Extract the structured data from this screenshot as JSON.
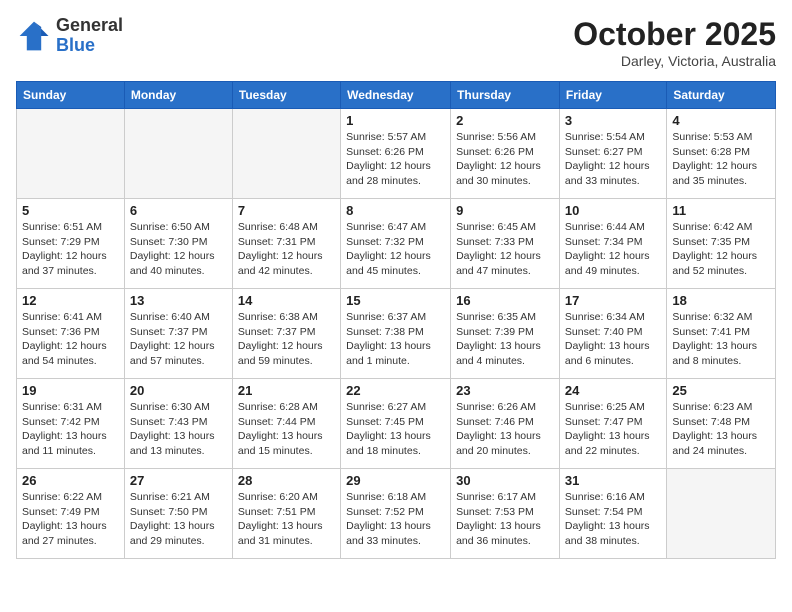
{
  "logo": {
    "general": "General",
    "blue": "Blue"
  },
  "title": {
    "month": "October 2025",
    "location": "Darley, Victoria, Australia"
  },
  "headers": [
    "Sunday",
    "Monday",
    "Tuesday",
    "Wednesday",
    "Thursday",
    "Friday",
    "Saturday"
  ],
  "weeks": [
    [
      {
        "day": "",
        "info": ""
      },
      {
        "day": "",
        "info": ""
      },
      {
        "day": "",
        "info": ""
      },
      {
        "day": "1",
        "info": "Sunrise: 5:57 AM\nSunset: 6:26 PM\nDaylight: 12 hours\nand 28 minutes."
      },
      {
        "day": "2",
        "info": "Sunrise: 5:56 AM\nSunset: 6:26 PM\nDaylight: 12 hours\nand 30 minutes."
      },
      {
        "day": "3",
        "info": "Sunrise: 5:54 AM\nSunset: 6:27 PM\nDaylight: 12 hours\nand 33 minutes."
      },
      {
        "day": "4",
        "info": "Sunrise: 5:53 AM\nSunset: 6:28 PM\nDaylight: 12 hours\nand 35 minutes."
      }
    ],
    [
      {
        "day": "5",
        "info": "Sunrise: 6:51 AM\nSunset: 7:29 PM\nDaylight: 12 hours\nand 37 minutes."
      },
      {
        "day": "6",
        "info": "Sunrise: 6:50 AM\nSunset: 7:30 PM\nDaylight: 12 hours\nand 40 minutes."
      },
      {
        "day": "7",
        "info": "Sunrise: 6:48 AM\nSunset: 7:31 PM\nDaylight: 12 hours\nand 42 minutes."
      },
      {
        "day": "8",
        "info": "Sunrise: 6:47 AM\nSunset: 7:32 PM\nDaylight: 12 hours\nand 45 minutes."
      },
      {
        "day": "9",
        "info": "Sunrise: 6:45 AM\nSunset: 7:33 PM\nDaylight: 12 hours\nand 47 minutes."
      },
      {
        "day": "10",
        "info": "Sunrise: 6:44 AM\nSunset: 7:34 PM\nDaylight: 12 hours\nand 49 minutes."
      },
      {
        "day": "11",
        "info": "Sunrise: 6:42 AM\nSunset: 7:35 PM\nDaylight: 12 hours\nand 52 minutes."
      }
    ],
    [
      {
        "day": "12",
        "info": "Sunrise: 6:41 AM\nSunset: 7:36 PM\nDaylight: 12 hours\nand 54 minutes."
      },
      {
        "day": "13",
        "info": "Sunrise: 6:40 AM\nSunset: 7:37 PM\nDaylight: 12 hours\nand 57 minutes."
      },
      {
        "day": "14",
        "info": "Sunrise: 6:38 AM\nSunset: 7:37 PM\nDaylight: 12 hours\nand 59 minutes."
      },
      {
        "day": "15",
        "info": "Sunrise: 6:37 AM\nSunset: 7:38 PM\nDaylight: 13 hours\nand 1 minute."
      },
      {
        "day": "16",
        "info": "Sunrise: 6:35 AM\nSunset: 7:39 PM\nDaylight: 13 hours\nand 4 minutes."
      },
      {
        "day": "17",
        "info": "Sunrise: 6:34 AM\nSunset: 7:40 PM\nDaylight: 13 hours\nand 6 minutes."
      },
      {
        "day": "18",
        "info": "Sunrise: 6:32 AM\nSunset: 7:41 PM\nDaylight: 13 hours\nand 8 minutes."
      }
    ],
    [
      {
        "day": "19",
        "info": "Sunrise: 6:31 AM\nSunset: 7:42 PM\nDaylight: 13 hours\nand 11 minutes."
      },
      {
        "day": "20",
        "info": "Sunrise: 6:30 AM\nSunset: 7:43 PM\nDaylight: 13 hours\nand 13 minutes."
      },
      {
        "day": "21",
        "info": "Sunrise: 6:28 AM\nSunset: 7:44 PM\nDaylight: 13 hours\nand 15 minutes."
      },
      {
        "day": "22",
        "info": "Sunrise: 6:27 AM\nSunset: 7:45 PM\nDaylight: 13 hours\nand 18 minutes."
      },
      {
        "day": "23",
        "info": "Sunrise: 6:26 AM\nSunset: 7:46 PM\nDaylight: 13 hours\nand 20 minutes."
      },
      {
        "day": "24",
        "info": "Sunrise: 6:25 AM\nSunset: 7:47 PM\nDaylight: 13 hours\nand 22 minutes."
      },
      {
        "day": "25",
        "info": "Sunrise: 6:23 AM\nSunset: 7:48 PM\nDaylight: 13 hours\nand 24 minutes."
      }
    ],
    [
      {
        "day": "26",
        "info": "Sunrise: 6:22 AM\nSunset: 7:49 PM\nDaylight: 13 hours\nand 27 minutes."
      },
      {
        "day": "27",
        "info": "Sunrise: 6:21 AM\nSunset: 7:50 PM\nDaylight: 13 hours\nand 29 minutes."
      },
      {
        "day": "28",
        "info": "Sunrise: 6:20 AM\nSunset: 7:51 PM\nDaylight: 13 hours\nand 31 minutes."
      },
      {
        "day": "29",
        "info": "Sunrise: 6:18 AM\nSunset: 7:52 PM\nDaylight: 13 hours\nand 33 minutes."
      },
      {
        "day": "30",
        "info": "Sunrise: 6:17 AM\nSunset: 7:53 PM\nDaylight: 13 hours\nand 36 minutes."
      },
      {
        "day": "31",
        "info": "Sunrise: 6:16 AM\nSunset: 7:54 PM\nDaylight: 13 hours\nand 38 minutes."
      },
      {
        "day": "",
        "info": ""
      }
    ]
  ]
}
